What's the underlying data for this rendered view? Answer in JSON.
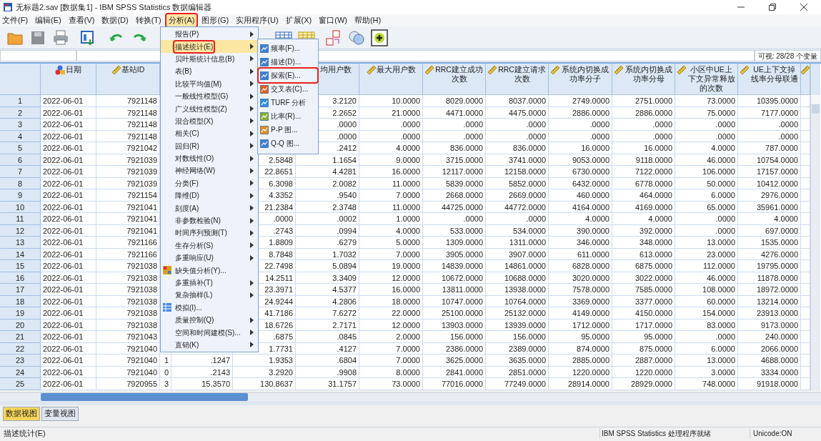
{
  "window": {
    "title": "无标题2.sav [数据集1] - IBM SPSS Statistics 数据编辑器"
  },
  "menu_bar": [
    {
      "label": "文件(F)",
      "selected": false,
      "outlined": false
    },
    {
      "label": "编辑(E)",
      "selected": false,
      "outlined": false
    },
    {
      "label": "查看(V)",
      "selected": false,
      "outlined": false
    },
    {
      "label": "数据(D)",
      "selected": false,
      "outlined": false
    },
    {
      "label": "转换(T)",
      "selected": false,
      "outlined": false
    },
    {
      "label": "分析(A)",
      "selected": true,
      "outlined": true
    },
    {
      "label": "图形(G)",
      "selected": false,
      "outlined": false
    },
    {
      "label": "实用程序(U)",
      "selected": false,
      "outlined": false
    },
    {
      "label": "扩展(X)",
      "selected": false,
      "outlined": false
    },
    {
      "label": "窗口(W)",
      "selected": false,
      "outlined": false
    },
    {
      "label": "帮助(H)",
      "selected": false,
      "outlined": false
    }
  ],
  "analysis_menu": [
    {
      "label": "报告(P)",
      "kind": "submenu",
      "selected": false,
      "outlined": false
    },
    {
      "label": "描述统计(E)",
      "kind": "submenu",
      "selected": true,
      "outlined": true
    },
    {
      "label": "贝叶斯统计信息(B)",
      "kind": "submenu",
      "selected": false,
      "outlined": false
    },
    {
      "label": "表(B)",
      "kind": "submenu",
      "selected": false,
      "outlined": false
    },
    {
      "label": "比较平均值(M)",
      "kind": "submenu",
      "selected": false,
      "outlined": false
    },
    {
      "label": "一般线性模型(G)",
      "kind": "submenu",
      "selected": false,
      "outlined": false
    },
    {
      "label": "广义线性模型(Z)",
      "kind": "submenu",
      "selected": false,
      "outlined": false
    },
    {
      "label": "混合模型(X)",
      "kind": "submenu",
      "selected": false,
      "outlined": false
    },
    {
      "label": "相关(C)",
      "kind": "submenu",
      "selected": false,
      "outlined": false
    },
    {
      "label": "回归(R)",
      "kind": "submenu",
      "selected": false,
      "outlined": false
    },
    {
      "label": "对数线性(O)",
      "kind": "submenu",
      "selected": false,
      "outlined": false
    },
    {
      "label": "神经网络(W)",
      "kind": "submenu",
      "selected": false,
      "outlined": false
    },
    {
      "label": "分类(F)",
      "kind": "submenu",
      "selected": false,
      "outlined": false
    },
    {
      "label": "降维(D)",
      "kind": "submenu",
      "selected": false,
      "outlined": false
    },
    {
      "label": "刻度(A)",
      "kind": "submenu",
      "selected": false,
      "outlined": false
    },
    {
      "label": "非参数检验(N)",
      "kind": "submenu",
      "selected": false,
      "outlined": false
    },
    {
      "label": "时间序列预测(T)",
      "kind": "submenu",
      "selected": false,
      "outlined": false
    },
    {
      "label": "生存分析(S)",
      "kind": "submenu",
      "selected": false,
      "outlined": false
    },
    {
      "label": "多重响应(U)",
      "kind": "submenu",
      "selected": false,
      "outlined": false
    },
    {
      "label": "缺失值分析(Y)...",
      "kind": "dialog",
      "selected": false,
      "outlined": false
    },
    {
      "label": "多重插补(T)",
      "kind": "submenu",
      "selected": false,
      "outlined": false
    },
    {
      "label": "复杂抽样(L)",
      "kind": "submenu",
      "selected": false,
      "outlined": false
    },
    {
      "label": "模拟(I)...",
      "kind": "dialog",
      "selected": false,
      "outlined": false
    },
    {
      "label": "质量控制(Q)",
      "kind": "submenu",
      "selected": false,
      "outlined": false
    },
    {
      "label": "空间和时间建模(S)...",
      "kind": "submenu",
      "selected": false,
      "outlined": false
    },
    {
      "label": "直销(K)",
      "kind": "submenu",
      "selected": false,
      "outlined": false
    }
  ],
  "descriptive_submenu": [
    {
      "label": "频率(F)...",
      "outlined": false
    },
    {
      "label": "描述(D)...",
      "outlined": false
    },
    {
      "label": "探索(E)...",
      "outlined": true
    },
    {
      "label": "交叉表(C)...",
      "outlined": false
    },
    {
      "label": "TURF 分析",
      "outlined": false
    },
    {
      "label": "比率(R)...",
      "outlined": false
    },
    {
      "label": "P-P 图...",
      "outlined": false
    },
    {
      "label": "Q-Q 图...",
      "outlined": false
    }
  ],
  "variables_visible": "可视: 28/28 个变量",
  "table": {
    "columns": [
      {
        "label": "日期",
        "kind": "nominal"
      },
      {
        "label": "基站ID",
        "kind": "scale"
      },
      {
        "label": "均用户数",
        "kind": "plain"
      },
      {
        "label": "最大用户数",
        "kind": "scale"
      },
      {
        "label": "RRC建立成功次数",
        "kind": "scale"
      },
      {
        "label": "RRC建立请求次数",
        "kind": "scale"
      },
      {
        "label": "系统内切换成功率分子",
        "kind": "scale"
      },
      {
        "label": "系统内切换成功率分母",
        "kind": "scale"
      },
      {
        "label": "小区中UE上下文异常释放的次数",
        "kind": "scale"
      },
      {
        "label": "UE上下文掉线率分母联通",
        "kind": "scale"
      },
      {
        "kind": "scale"
      }
    ],
    "rows": [
      {
        "number": "1",
        "cells": [
          "2022-06-01",
          "7921148",
          "3.2120",
          "10.0000",
          "8029.0000",
          "8037.0000",
          "2749.0000",
          "2751.0000",
          "73.0000",
          "10395.0000"
        ]
      },
      {
        "number": "2",
        "cells": [
          "2022-06-01",
          "7921148",
          "2.2652",
          "21.0000",
          "4471.0000",
          "4475.0000",
          "2886.0000",
          "2886.0000",
          "75.0000",
          "7177.0000"
        ]
      },
      {
        "number": "3",
        "cells": [
          "2022-06-01",
          "7921148",
          ".0000",
          ".0000",
          ".0000",
          ".0000",
          ".0000",
          ".0000",
          ".0000",
          ".0000"
        ]
      },
      {
        "number": "4",
        "cells": [
          "2022-06-01",
          "7921148",
          ".0000",
          ".0000",
          ".0000",
          ".0000",
          ".0000",
          ".0000",
          ".0000",
          ".0000"
        ]
      },
      {
        "number": "5",
        "cells": [
          "2022-06-01",
          "7921042",
          ".2412",
          "4.0000",
          "836.0000",
          "836.0000",
          "16.0000",
          "16.0000",
          "4.0000",
          "787.0000"
        ]
      },
      {
        "number": "6",
        "cells": [
          "2022-06-01",
          "7921039",
          "2.5848",
          "1.1654",
          "9.0000",
          "3715.0000",
          "3741.0000",
          "9053.0000",
          "9118.0000",
          "46.0000",
          "10754.0000"
        ]
      },
      {
        "number": "7",
        "cells": [
          "2022-06-01",
          "7921039",
          "22.8651",
          "4.4281",
          "16.0000",
          "12117.0000",
          "12158.0000",
          "6730.0000",
          "7122.0000",
          "106.0000",
          "17157.0000"
        ]
      },
      {
        "number": "8",
        "cells": [
          "2022-06-01",
          "7921039",
          "6.3098",
          "2.0082",
          "11.0000",
          "5839.0000",
          "5852.0000",
          "6432.0000",
          "6778.0000",
          "50.0000",
          "10412.0000"
        ]
      },
      {
        "number": "9",
        "cells": [
          "2022-06-01",
          "7921154",
          "4.3352",
          ".9540",
          "7.0000",
          "2668.0000",
          "2669.0000",
          "460.0000",
          "464.0000",
          "6.0000",
          "2976.0000"
        ]
      },
      {
        "number": "10",
        "cells": [
          "2022-06-01",
          "7921041",
          "21.2384",
          "2.3748",
          "11.0000",
          "44725.0000",
          "44772.0000",
          "4164.0000",
          "4169.0000",
          "65.0000",
          "35961.0000"
        ]
      },
      {
        "number": "11",
        "cells": [
          "2022-06-01",
          "7921041",
          ".0000",
          ".0002",
          "1.0000",
          ".0000",
          ".0000",
          "4.0000",
          "4.0000",
          ".0000",
          "4.0000"
        ]
      },
      {
        "number": "12",
        "cells": [
          "2022-06-01",
          "7921041",
          ".2743",
          ".0994",
          "4.0000",
          "533.0000",
          "534.0000",
          "390.0000",
          "392.0000",
          ".0000",
          "697.0000"
        ]
      },
      {
        "number": "13",
        "cells": [
          "2022-06-01",
          "7921166",
          "1.8809",
          ".6279",
          "5.0000",
          "1309.0000",
          "1311.0000",
          "346.0000",
          "348.0000",
          "13.0000",
          "1535.0000"
        ]
      },
      {
        "number": "14",
        "cells": [
          "2022-06-01",
          "7921166",
          "8.7848",
          "1.7032",
          "7.0000",
          "3905.0000",
          "3907.0000",
          "611.0000",
          "613.0000",
          "23.0000",
          "4276.0000"
        ]
      },
      {
        "number": "15",
        "cells": [
          "2022-06-01",
          "7921038",
          "22.7498",
          "5.0894",
          "19.0000",
          "14839.0000",
          "14861.0000",
          "6828.0000",
          "6875.0000",
          "112.0000",
          "19795.0000"
        ]
      },
      {
        "number": "16",
        "cells": [
          "2022-06-01",
          "7921038",
          "14.2511",
          "3.3409",
          "12.0000",
          "10672.0000",
          "10688.0000",
          "3020.0000",
          "3022.0000",
          "46.0000",
          "11878.0000"
        ]
      },
      {
        "number": "17",
        "cells": [
          "2022-06-01",
          "7921038",
          "23.3971",
          "4.5377",
          "16.0000",
          "13811.0000",
          "13938.0000",
          "7578.0000",
          "7585.0000",
          "108.0000",
          "18972.0000"
        ]
      },
      {
        "number": "18",
        "cells": [
          "2022-06-01",
          "7921038",
          "24.9244",
          "4.2806",
          "18.0000",
          "10747.0000",
          "10764.0000",
          "3369.0000",
          "3377.0000",
          "60.0000",
          "13214.0000"
        ]
      },
      {
        "number": "19",
        "cells": [
          "2022-06-01",
          "7921038",
          "41.7186",
          "7.6272",
          "22.0000",
          "25100.0000",
          "25132.0000",
          "4149.0000",
          "4150.0000",
          "154.0000",
          "23913.0000"
        ]
      },
      {
        "number": "20",
        "cells": [
          "2022-06-01",
          "7921038",
          "18.6726",
          "2.7171",
          "12.0000",
          "13903.0000",
          "13939.0000",
          "1712.0000",
          "1717.0000",
          "83.0000",
          "9173.0000"
        ]
      },
      {
        "number": "21",
        "cells": [
          "2022-06-01",
          "7921043",
          ".6875",
          ".0845",
          "2.0000",
          "156.0000",
          "156.0000",
          "95.0000",
          "95.0000",
          ".0000",
          "240.0000"
        ]
      },
      {
        "number": "22",
        "cells": [
          "2022-06-01",
          "7921040",
          "1.7731",
          ".4127",
          "7.0000",
          "2386.0000",
          "2389.0000",
          "874.0000",
          "875.0000",
          "6.0000",
          "2066.0000"
        ]
      },
      {
        "number": "23",
        "cells": [
          "2022-06-01",
          "7921040",
          "1",
          ".1247",
          "1.9353",
          ".6804",
          "7.0000",
          "3625.0000",
          "3635.0000",
          "2885.0000",
          "2887.0000",
          "13.0000",
          "4688.0000"
        ]
      },
      {
        "number": "24",
        "cells": [
          "2022-06-01",
          "7921040",
          "0",
          ".2143",
          "3.2920",
          ".9908",
          "8.0000",
          "2841.0000",
          "2851.0000",
          "1220.0000",
          "1220.0000",
          "3.0000",
          "3334.0000"
        ]
      },
      {
        "number": "25",
        "cells": [
          "2022-06-01",
          "7920955",
          "3",
          "15.3570",
          "130.8637",
          "31.1757",
          "73.0000",
          "77016.0000",
          "77249.0000",
          "28914.0000",
          "28929.0000",
          "748.0000",
          "91918.0000"
        ]
      }
    ]
  },
  "view_tabs": [
    {
      "label": "数据视图",
      "selected": true
    },
    {
      "label": "变量视图",
      "selected": false
    }
  ],
  "status_bar": {
    "left": "描述统计(E)",
    "processor": "IBM SPSS Statistics 处理程序就绪",
    "unicode": "Unicode:ON"
  }
}
